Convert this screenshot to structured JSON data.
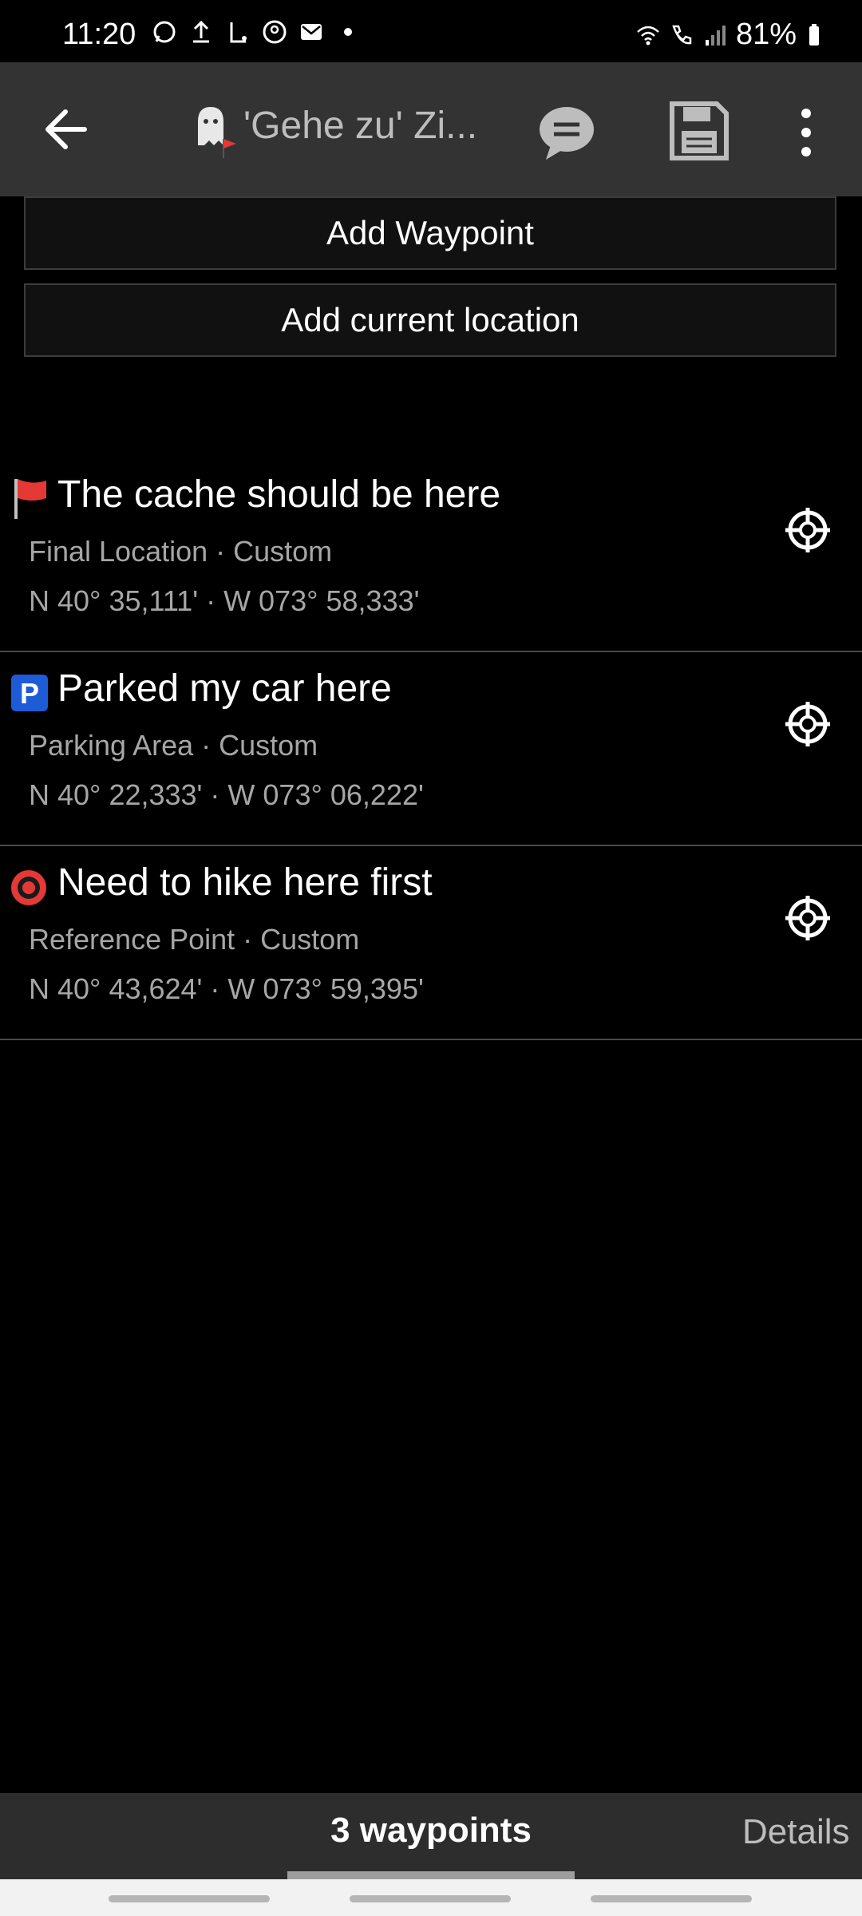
{
  "status_bar": {
    "time": "11:20",
    "battery": "81%",
    "left_icons": [
      "whatsapp-icon",
      "upload-icon",
      "app-icon",
      "location-icon",
      "mail-icon",
      "dot-icon"
    ],
    "right_icons": [
      "wifi-icon",
      "call-icon",
      "signal-icon",
      "battery-icon"
    ]
  },
  "app_bar": {
    "title": "'Gehe zu' Zi...",
    "icons": [
      "back-arrow-icon",
      "cache-ghost-icon",
      "log-chat-icon",
      "save-icon",
      "more-options-icon"
    ]
  },
  "actions": {
    "add_waypoint": "Add Waypoint",
    "add_current_location": "Add current location"
  },
  "waypoints": [
    {
      "icon": "final-flag-icon",
      "name": "The cache should be here",
      "type": "Final Location · Custom",
      "coords": "N 40° 35,111' · W 073° 58,333'"
    },
    {
      "icon": "parking-icon",
      "name": "Parked my car here",
      "type": "Parking Area · Custom",
      "coords": "N 40° 22,333' · W 073° 06,222'"
    },
    {
      "icon": "reference-point-icon",
      "name": "Need to hike here first",
      "type": "Reference Point · Custom",
      "coords": "N 40° 43,624' · W 073° 59,395'"
    }
  ],
  "tabs": {
    "active": "3 waypoints",
    "next": "Details"
  },
  "colors": {
    "background": "#000000",
    "app_bar": "#333333",
    "secondary_text": "#a6a6a6",
    "flag_red": "#e53935",
    "parking_blue": "#1e5bd6"
  }
}
